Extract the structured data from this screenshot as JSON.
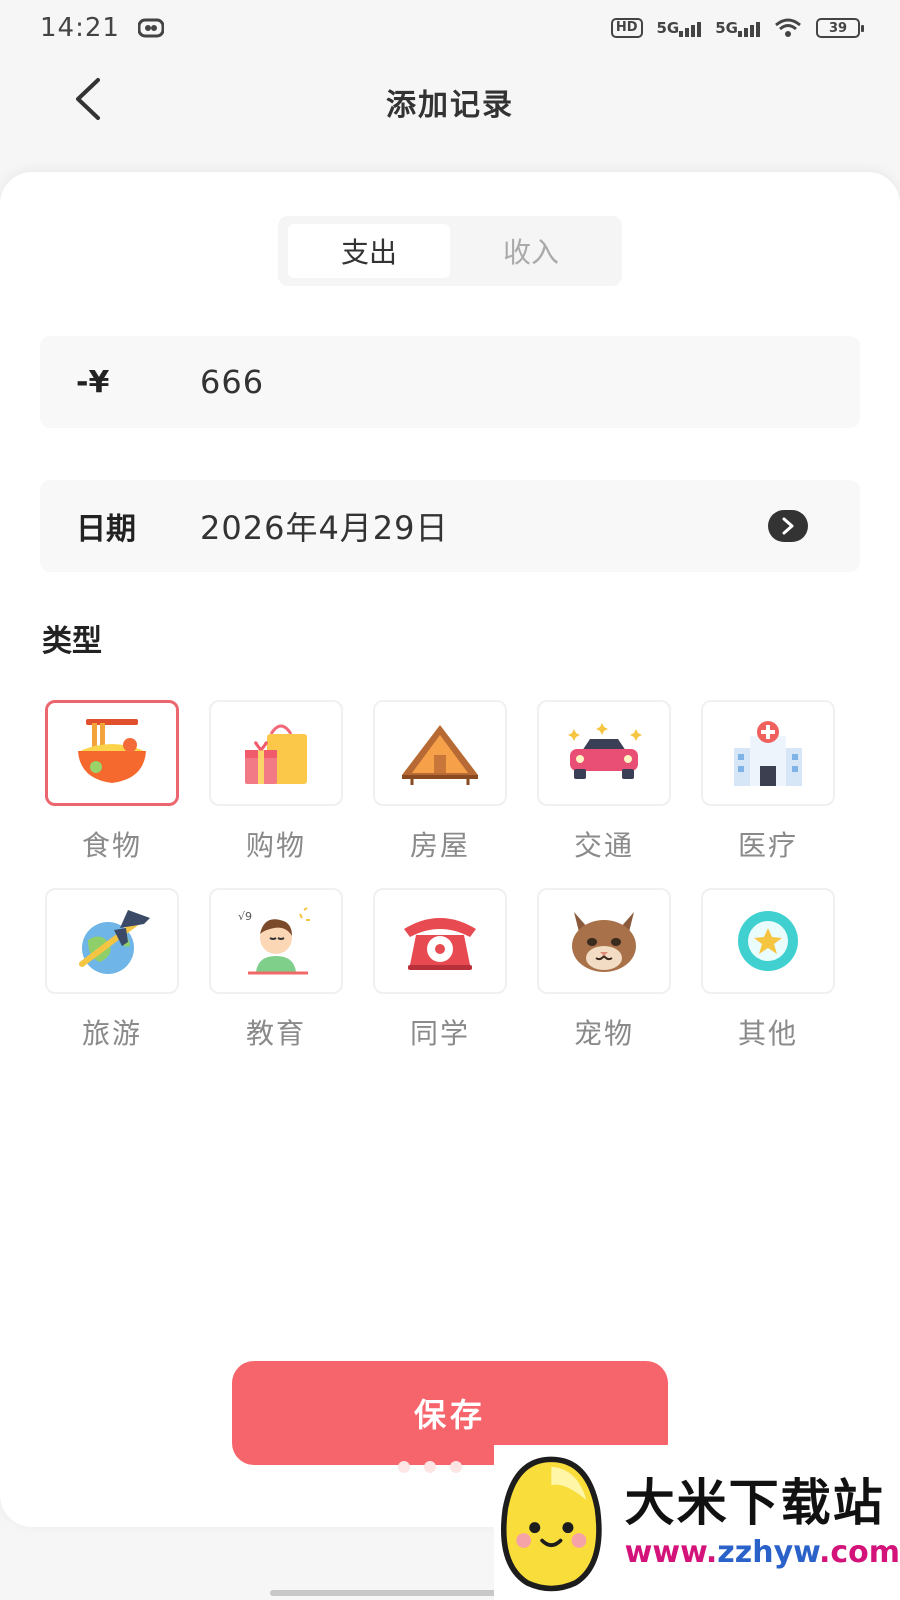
{
  "status_bar": {
    "time": "14:21",
    "hd": "HD",
    "net1": "5G",
    "net2": "5G",
    "battery": "39"
  },
  "header": {
    "title": "添加记录"
  },
  "toggle": {
    "options": [
      "支出",
      "收入"
    ],
    "selected": "支出"
  },
  "amount": {
    "label": "-¥",
    "value": "666"
  },
  "date": {
    "label": "日期",
    "value": "2026年4月29日"
  },
  "category_section": {
    "title": "类型",
    "selected": "食物",
    "items": [
      {
        "label": "食物",
        "icon": "noodle-bowl-icon"
      },
      {
        "label": "购物",
        "icon": "shopping-bag-icon"
      },
      {
        "label": "房屋",
        "icon": "house-icon"
      },
      {
        "label": "交通",
        "icon": "car-icon"
      },
      {
        "label": "医疗",
        "icon": "hospital-icon"
      },
      {
        "label": "旅游",
        "icon": "airplane-globe-icon"
      },
      {
        "label": "教育",
        "icon": "student-icon"
      },
      {
        "label": "同学",
        "icon": "telephone-icon"
      },
      {
        "label": "宠物",
        "icon": "cat-icon"
      },
      {
        "label": "其他",
        "icon": "star-ring-icon"
      }
    ]
  },
  "save_button": {
    "label": "保存"
  },
  "watermark": {
    "brand": "大米下载站",
    "url_a": "www.",
    "url_b": "zzhyw",
    "url_c": ".com"
  },
  "colors": {
    "accent": "#f7656c",
    "selected_border": "#ec6670"
  }
}
